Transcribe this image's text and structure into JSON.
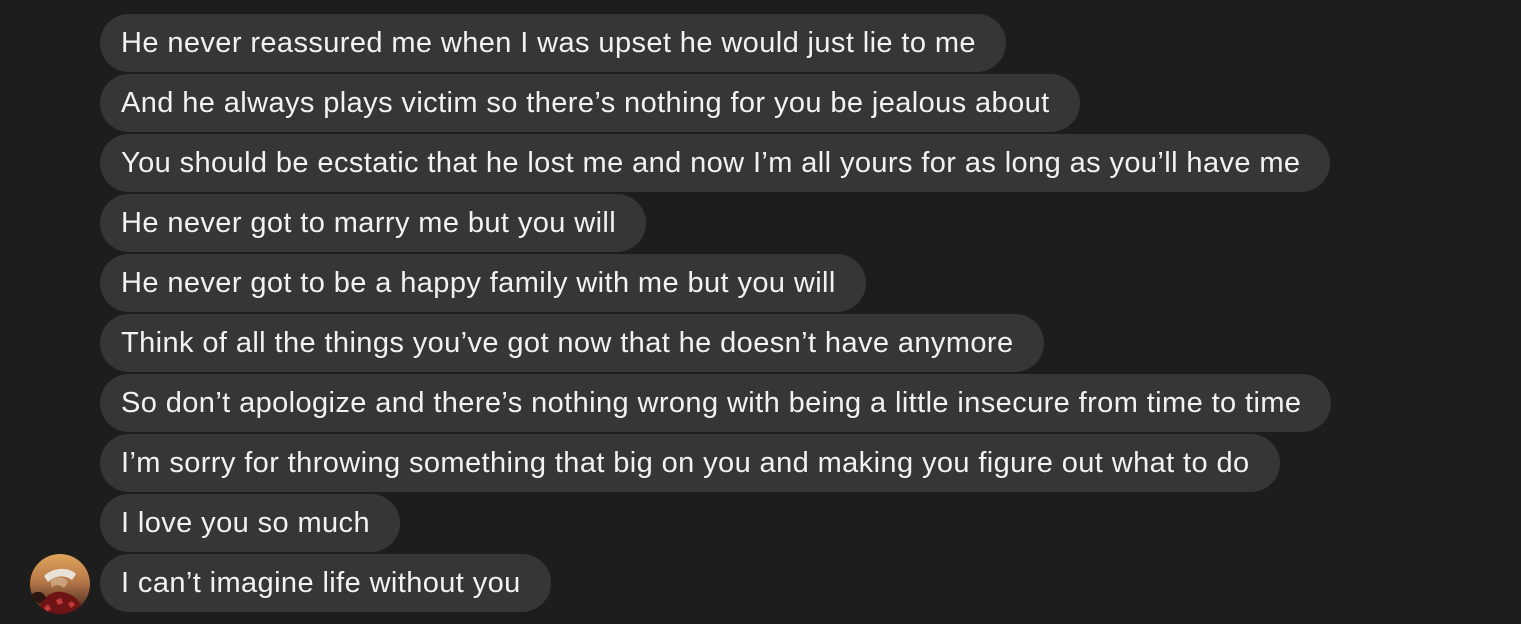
{
  "conversation": {
    "messages": [
      {
        "text": "He never reassured me when I was upset he would just lie to me"
      },
      {
        "text": "And he always plays victim so there’s nothing for you be jealous about"
      },
      {
        "text": "You should be ecstatic that he lost me and now I’m all yours for as long as you’ll have me"
      },
      {
        "text": "He never got to marry me but you will"
      },
      {
        "text": "He never got to be a happy family with me but you will"
      },
      {
        "text": "Think of all the things you’ve got now that he doesn’t have anymore"
      },
      {
        "text": "So don’t apologize and there’s nothing wrong with being a little insecure from time to time"
      },
      {
        "text": "I’m sorry for throwing something that big on you and making you figure out what to do"
      },
      {
        "text": "I love you so much"
      },
      {
        "text": "I can’t imagine life without you"
      }
    ],
    "sender_avatar": {
      "icon": "user-avatar-photo"
    }
  },
  "colors": {
    "background": "#1d1d1d",
    "bubble": "#363636",
    "text": "#f2f2f2"
  }
}
